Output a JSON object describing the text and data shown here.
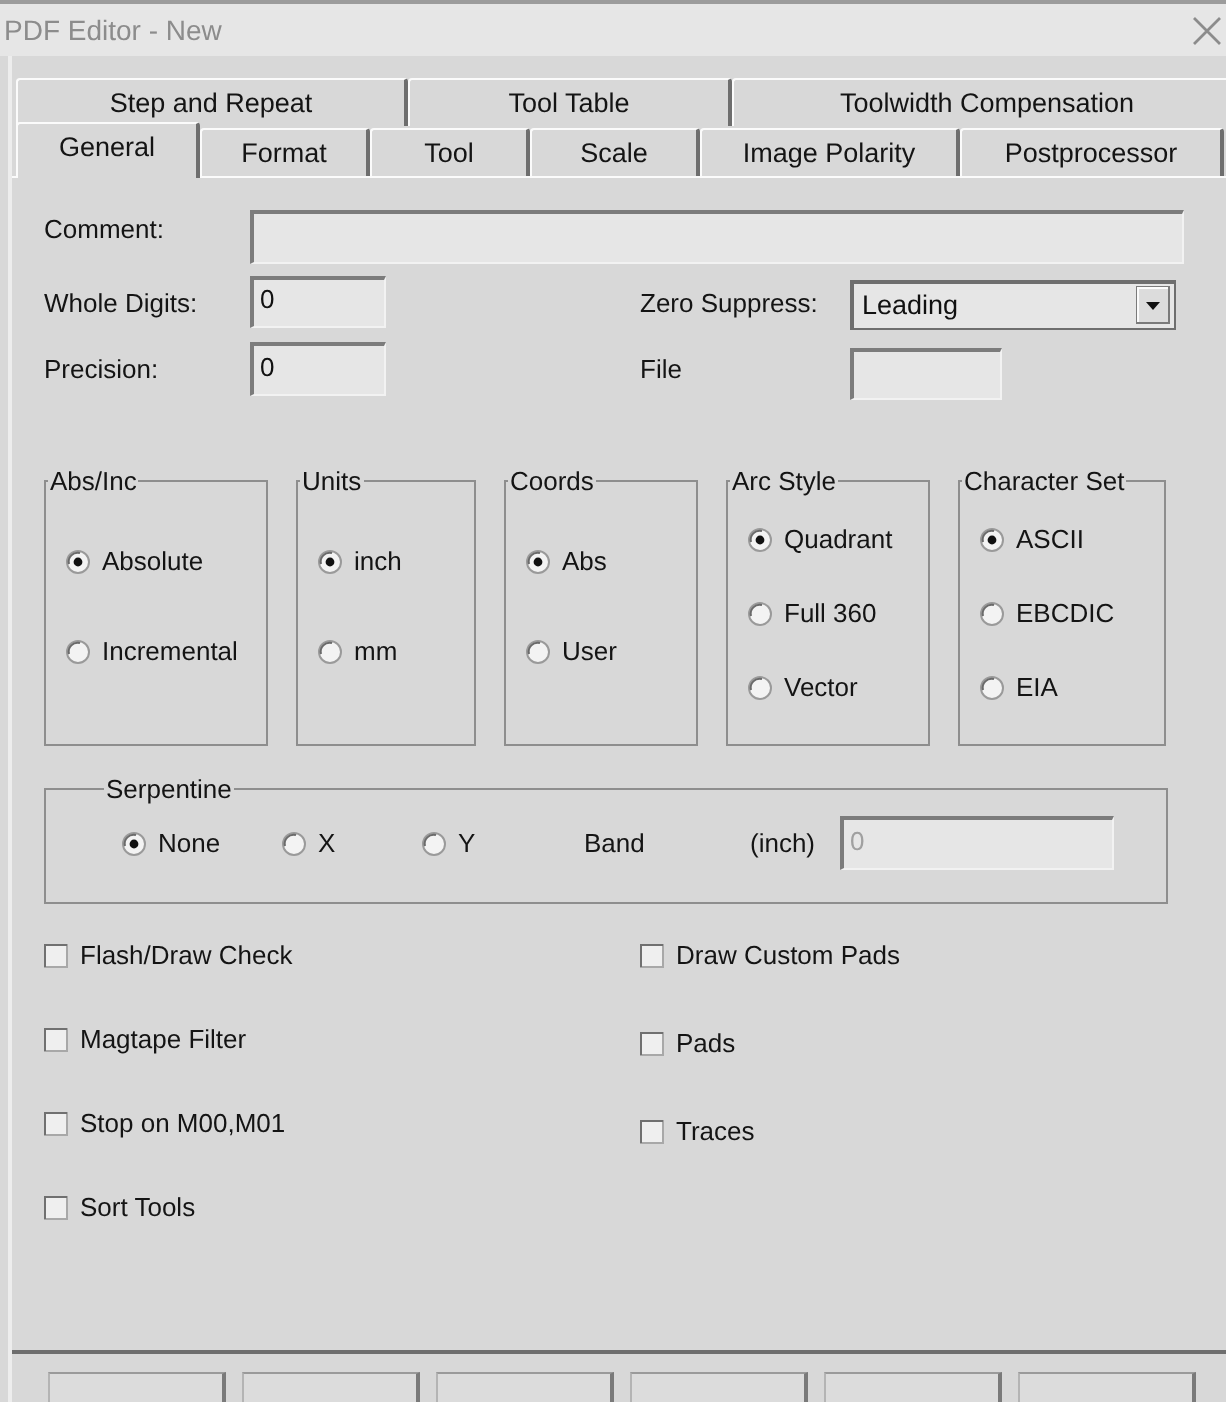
{
  "window": {
    "title": "PDF Editor - New"
  },
  "tab_rows": [
    {
      "tabs": [
        {
          "label": "Step and Repeat",
          "selected": false
        },
        {
          "label": "Tool Table",
          "selected": false
        },
        {
          "label": "Toolwidth Compensation",
          "selected": false
        }
      ]
    },
    {
      "tabs": [
        {
          "label": "General",
          "selected": true
        },
        {
          "label": "Format",
          "selected": false
        },
        {
          "label": "Tool",
          "selected": false
        },
        {
          "label": "Scale",
          "selected": false
        },
        {
          "label": "Image Polarity",
          "selected": false
        },
        {
          "label": "Postprocessor",
          "selected": false
        }
      ]
    }
  ],
  "comment": {
    "label": "Comment:"
  },
  "whole_digits": {
    "label": "Whole Digits:",
    "value": "0"
  },
  "zero_suppress": {
    "label": "Zero Suppress:",
    "value": "Leading"
  },
  "precision": {
    "label": "Precision:",
    "value": "0"
  },
  "file_field": {
    "label": "File"
  },
  "option_groups": [
    {
      "title": "Abs/Inc",
      "options": [
        {
          "label": "Absolute",
          "selected": true
        },
        {
          "label": "Incremental",
          "selected": false
        }
      ]
    },
    {
      "title": "Units",
      "options": [
        {
          "label": "inch",
          "selected": true
        },
        {
          "label": "mm",
          "selected": false
        }
      ]
    },
    {
      "title": "Coords",
      "options": [
        {
          "label": "Abs",
          "selected": true
        },
        {
          "label": "User",
          "selected": false
        }
      ]
    },
    {
      "title": "Arc Style",
      "options": [
        {
          "label": "Quadrant",
          "selected": true
        },
        {
          "label": "Full 360",
          "selected": false
        },
        {
          "label": "Vector",
          "selected": false
        }
      ]
    },
    {
      "title": "Character Set",
      "options": [
        {
          "label": "ASCII",
          "selected": true
        },
        {
          "label": "EBCDIC",
          "selected": false
        },
        {
          "label": "EIA",
          "selected": false
        }
      ]
    }
  ],
  "serpentine": {
    "title": "Serpentine",
    "options": [
      {
        "label": "None",
        "selected": true
      },
      {
        "label": "X",
        "selected": false
      },
      {
        "label": "Y",
        "selected": false
      }
    ],
    "band_label": "Band",
    "unit_label": "(inch)",
    "band_field": {
      "value": "0",
      "disabled": true
    }
  },
  "checkbox_columns": [
    {
      "items": [
        {
          "label": "Flash/Draw Check",
          "checked": false
        },
        {
          "label": "Magtape Filter",
          "checked": false
        },
        {
          "label": "Stop on M00,M01",
          "checked": false
        },
        {
          "label": "Sort Tools",
          "checked": false
        }
      ]
    },
    {
      "items": [
        {
          "label": "Draw Custom Pads",
          "checked": false
        },
        {
          "label": "Pads",
          "checked": false
        },
        {
          "label": "Traces",
          "checked": false
        }
      ]
    }
  ]
}
